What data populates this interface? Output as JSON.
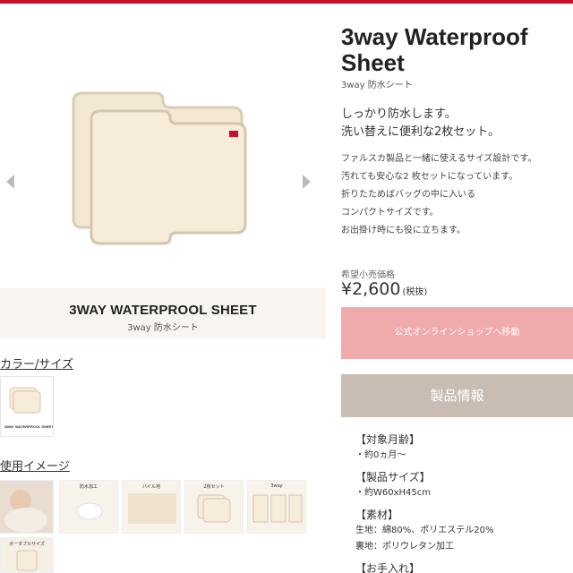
{
  "product": {
    "title": "3way Waterproof Sheet",
    "subtitle": "3way 防水シート",
    "catch_lines": [
      "しっかり防水します。",
      "洗い替えに便利な2枚セット。"
    ],
    "description_lines": [
      "ファルスカ製品と一緒に使えるサイズ設計です。",
      "汚れても安心な2 枚セットになっています。",
      "折りたためばバッグの中に入いる",
      "コンパクトサイズです。",
      "お出掛け時にも役に立ちます。"
    ],
    "price_label": "希望小売価格",
    "price": "¥2,600",
    "price_tax": "(税抜)",
    "shop_button": "公式オンラインショップへ移動"
  },
  "banner": {
    "title": "3WAY WATERPROOL SHEET",
    "subtitle": "3way 防水シート"
  },
  "sections": {
    "color_size": "カラー/サイズ",
    "usage_image": "使用イメージ"
  },
  "swatch": {
    "caption": "3WAY WATERPROOL SHEET"
  },
  "thumbnails": [
    {
      "label": ""
    },
    {
      "label": "防水加工"
    },
    {
      "label": "パイル地"
    },
    {
      "label": "2枚セット"
    },
    {
      "label": "3way"
    }
  ],
  "thumb_row2": {
    "label": "ポータブルサイズ"
  },
  "info": {
    "heading": "製品情報",
    "items": [
      {
        "head": "【対象月齢】",
        "values": [
          "・約0ヵ月〜"
        ]
      },
      {
        "head": "【製品サイズ】",
        "values": [
          "・約W60xH45cm"
        ]
      },
      {
        "head": "【素材】",
        "values": [
          "生地：綿80%、ポリエステル20%",
          "裏地：ポリウレタン加工"
        ]
      },
      {
        "head": "【お手入れ】",
        "values": []
      }
    ]
  },
  "colors": {
    "brand_red": "#c8102e",
    "shop_button": "#efabab",
    "info_header": "#c9bcb3",
    "sheet_cream": "#f6ecd9"
  },
  "icons": [
    "chevron-left-icon",
    "chevron-right-icon"
  ]
}
